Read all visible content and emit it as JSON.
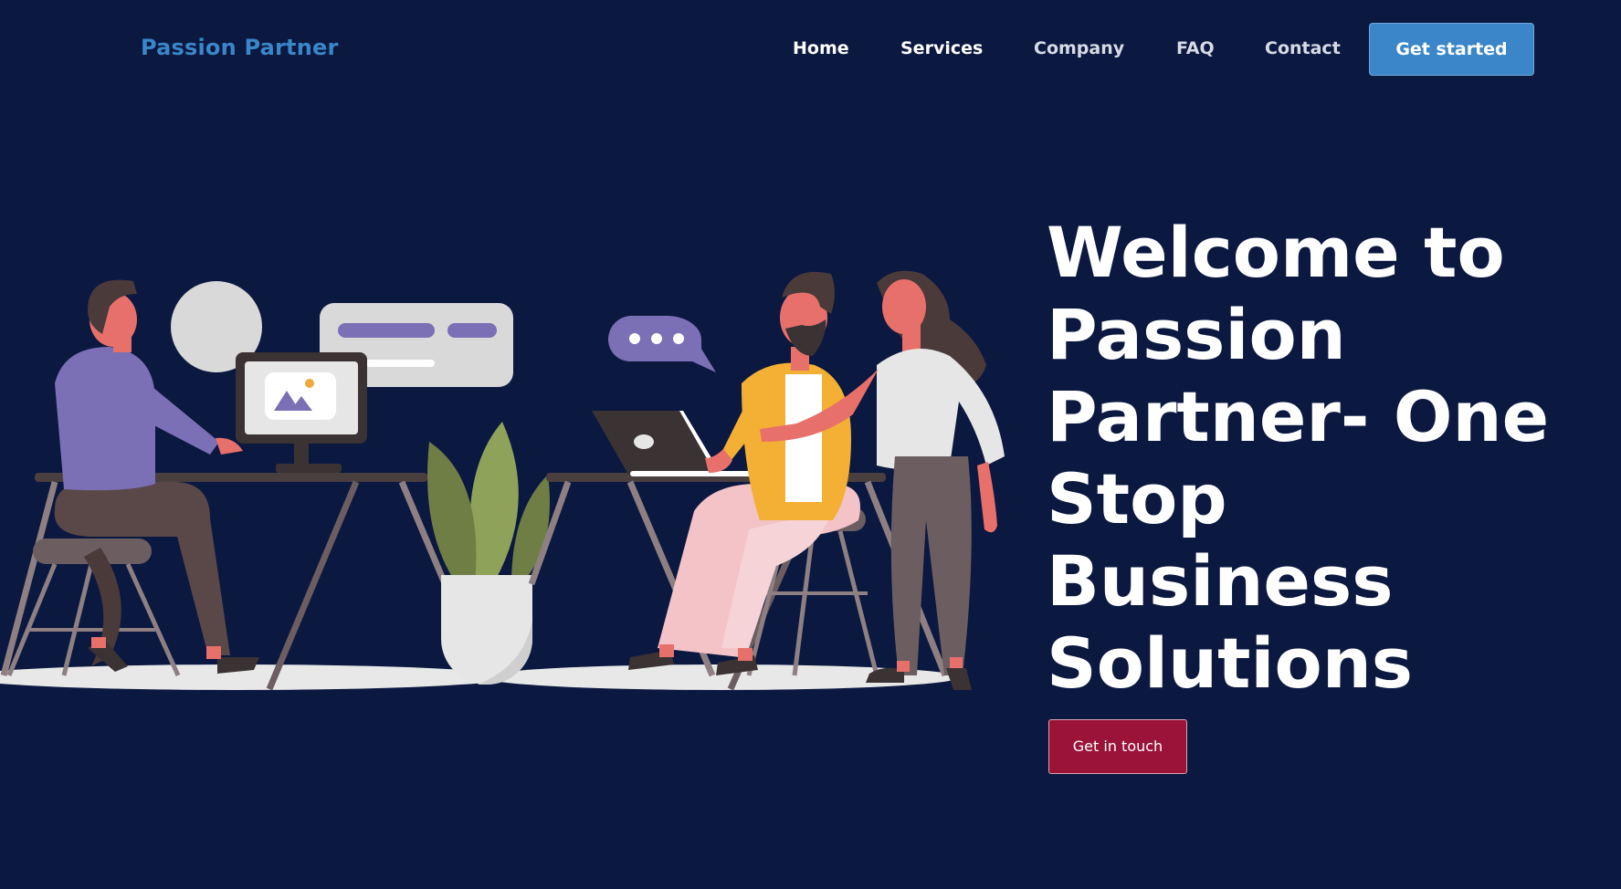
{
  "header": {
    "brand": "Passion Partner",
    "nav": [
      {
        "label": "Home"
      },
      {
        "label": "Services"
      },
      {
        "label": "Company"
      },
      {
        "label": "FAQ"
      },
      {
        "label": "Contact"
      }
    ],
    "cta_label": "Get started"
  },
  "hero": {
    "title": "Welcome to Passion Partner- One Stop Business Solutions",
    "button_label": "Get in touch"
  },
  "colors": {
    "background": "#0b1840",
    "brand": "#3a86c8",
    "cta": "#3a86c8",
    "secondary_button": "#9b1438"
  },
  "illustration": {
    "icon": "office-team-illustration"
  }
}
